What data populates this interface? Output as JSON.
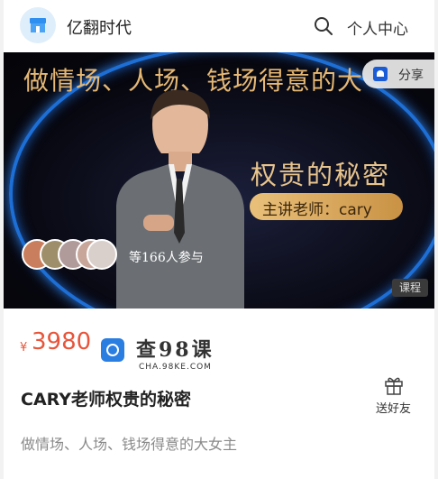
{
  "header": {
    "shop_name": "亿翻时代",
    "search_icon": "search-icon",
    "personal_center": "个人中心"
  },
  "banner": {
    "title": "做情场、人场、钱场得意的大",
    "share_label": "分享",
    "subtitle": "权贵的秘密",
    "teacher": "主讲老师：cary",
    "participants": "等166人参与",
    "tag": "课程",
    "colors": {
      "gold": "#e6b874",
      "ring_blue": "#1d6fd6"
    }
  },
  "product": {
    "price_symbol": "¥",
    "price": "3980",
    "watermark_main": "查98课",
    "watermark_sub": "CHA.98KE.COM",
    "title": "CARY老师权贵的秘密",
    "gift_label": "送好友",
    "description": "做情场、人场、钱场得意的大女主",
    "accent_color": "#e8553a"
  }
}
